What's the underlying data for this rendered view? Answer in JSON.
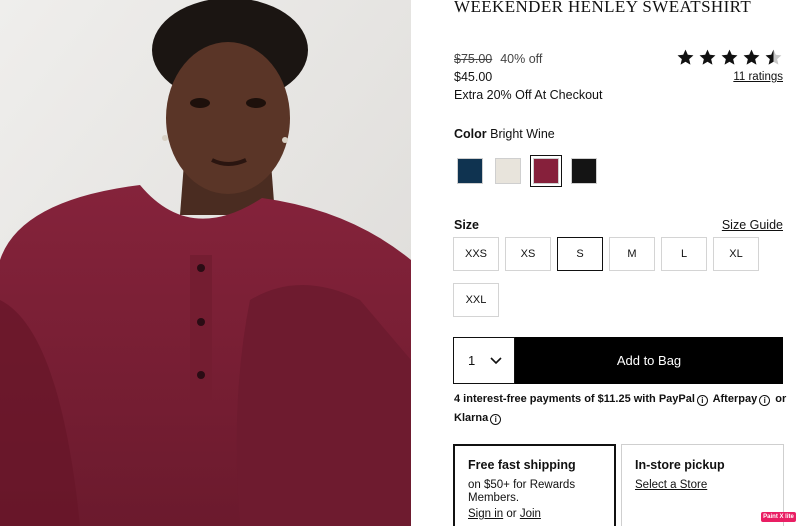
{
  "product": {
    "title": "WEEKENDER HENLEY SWEATSHIRT"
  },
  "price": {
    "original": "$75.00",
    "percent_off": "40% off",
    "current": "$45.00",
    "promo": "Extra 20% Off At Checkout"
  },
  "rating": {
    "value": 4.5,
    "max": 5,
    "ratings_text": "11 ratings"
  },
  "color": {
    "label": "Color",
    "selected_name": "Bright Wine",
    "swatches": [
      {
        "name": "navy",
        "hex": "#0f3350"
      },
      {
        "name": "cream",
        "hex": "#e8e4dc"
      },
      {
        "name": "bright-wine",
        "hex": "#86203b"
      },
      {
        "name": "black",
        "hex": "#141414"
      }
    ],
    "selected_index": 2
  },
  "size": {
    "label": "Size",
    "guide_label": "Size Guide",
    "options": [
      "XXS",
      "XS",
      "S",
      "M",
      "L",
      "XL",
      "XXL"
    ],
    "selected": "S"
  },
  "purchase": {
    "quantity": "1",
    "add_to_bag": "Add to Bag"
  },
  "payment": {
    "text": "4 interest-free payments of $11.25 with",
    "paypal": "PayPal",
    "afterpay": "Afterpay",
    "or": "or",
    "klarna": "Klarna",
    "info_glyph": "i"
  },
  "shipping": {
    "title": "Free fast shipping",
    "desc": "on $50+ for Rewards Members.",
    "sign_in": "Sign in",
    "or": "or",
    "join": "Join"
  },
  "pickup": {
    "title": "In-store pickup",
    "select_store": "Select a Store"
  },
  "badge": {
    "text": "Paint X lite"
  },
  "colors": {
    "sweatshirt": "#7a1e33",
    "background": "#e9e8e6",
    "button": "#000000"
  },
  "icons": [
    "star-icon",
    "half-star-icon",
    "chevron-down-icon",
    "info-icon"
  ]
}
